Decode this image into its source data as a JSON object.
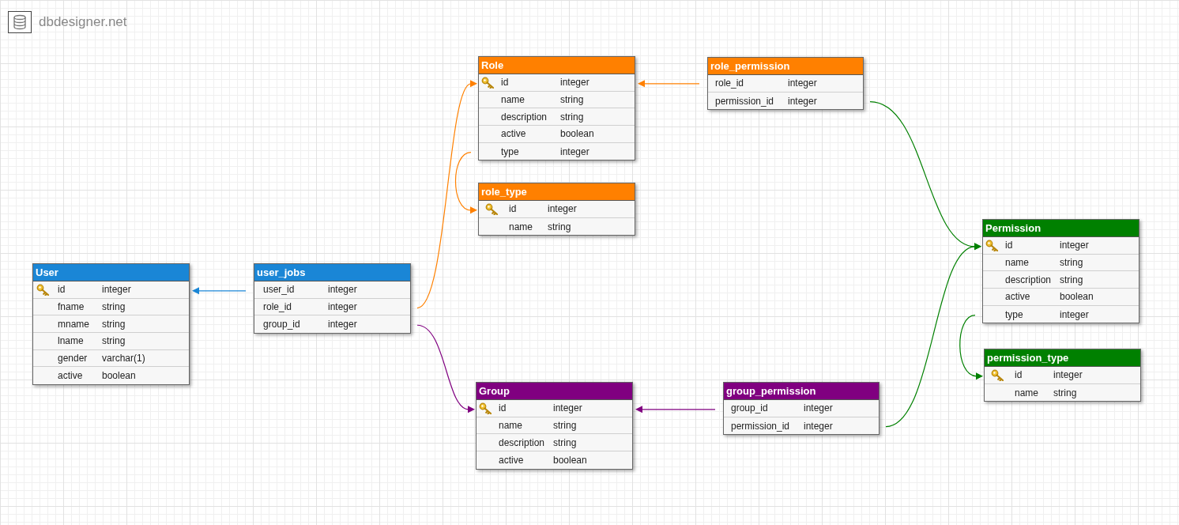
{
  "logo": {
    "text": "dbdesigner.net"
  },
  "tables": [
    {
      "name": "User",
      "color": "#1a86d6",
      "columns": [
        {
          "name": "id",
          "type": "integer",
          "primary_key": true
        },
        {
          "name": "fname",
          "type": "string",
          "primary_key": false
        },
        {
          "name": "mname",
          "type": "string",
          "primary_key": false
        },
        {
          "name": "lname",
          "type": "string",
          "primary_key": false
        },
        {
          "name": "gender",
          "type": "varchar(1)",
          "primary_key": false
        },
        {
          "name": "active",
          "type": "boolean",
          "primary_key": false
        }
      ]
    },
    {
      "name": "user_jobs",
      "color": "#1a86d6",
      "columns": [
        {
          "name": "user_id",
          "type": "integer",
          "primary_key": false
        },
        {
          "name": "role_id",
          "type": "integer",
          "primary_key": false
        },
        {
          "name": "group_id",
          "type": "integer",
          "primary_key": false
        }
      ]
    },
    {
      "name": "Role",
      "color": "#ff8000",
      "columns": [
        {
          "name": "id",
          "type": "integer",
          "primary_key": true
        },
        {
          "name": "name",
          "type": "string",
          "primary_key": false
        },
        {
          "name": "description",
          "type": "string",
          "primary_key": false
        },
        {
          "name": "active",
          "type": "boolean",
          "primary_key": false
        },
        {
          "name": "type",
          "type": "integer",
          "primary_key": false
        }
      ]
    },
    {
      "name": "role_permission",
      "color": "#ff8000",
      "columns": [
        {
          "name": "role_id",
          "type": "integer",
          "primary_key": false
        },
        {
          "name": "permission_id",
          "type": "integer",
          "primary_key": false
        }
      ]
    },
    {
      "name": "role_type",
      "color": "#ff8000",
      "columns": [
        {
          "name": "id",
          "type": "integer",
          "primary_key": true
        },
        {
          "name": "name",
          "type": "string",
          "primary_key": false
        }
      ]
    },
    {
      "name": "Permission",
      "color": "#008000",
      "columns": [
        {
          "name": "id",
          "type": "integer",
          "primary_key": true
        },
        {
          "name": "name",
          "type": "string",
          "primary_key": false
        },
        {
          "name": "description",
          "type": "string",
          "primary_key": false
        },
        {
          "name": "active",
          "type": "boolean",
          "primary_key": false
        },
        {
          "name": "type",
          "type": "integer",
          "primary_key": false
        }
      ]
    },
    {
      "name": "permission_type",
      "color": "#008000",
      "columns": [
        {
          "name": "id",
          "type": "integer",
          "primary_key": true
        },
        {
          "name": "name",
          "type": "string",
          "primary_key": false
        }
      ]
    },
    {
      "name": "Group",
      "color": "#800080",
      "columns": [
        {
          "name": "id",
          "type": "integer",
          "primary_key": true
        },
        {
          "name": "name",
          "type": "string",
          "primary_key": false
        },
        {
          "name": "description",
          "type": "string",
          "primary_key": false
        },
        {
          "name": "active",
          "type": "boolean",
          "primary_key": false
        }
      ]
    },
    {
      "name": "group_permission",
      "color": "#800080",
      "columns": [
        {
          "name": "group_id",
          "type": "integer",
          "primary_key": false
        },
        {
          "name": "permission_id",
          "type": "integer",
          "primary_key": false
        }
      ]
    }
  ]
}
